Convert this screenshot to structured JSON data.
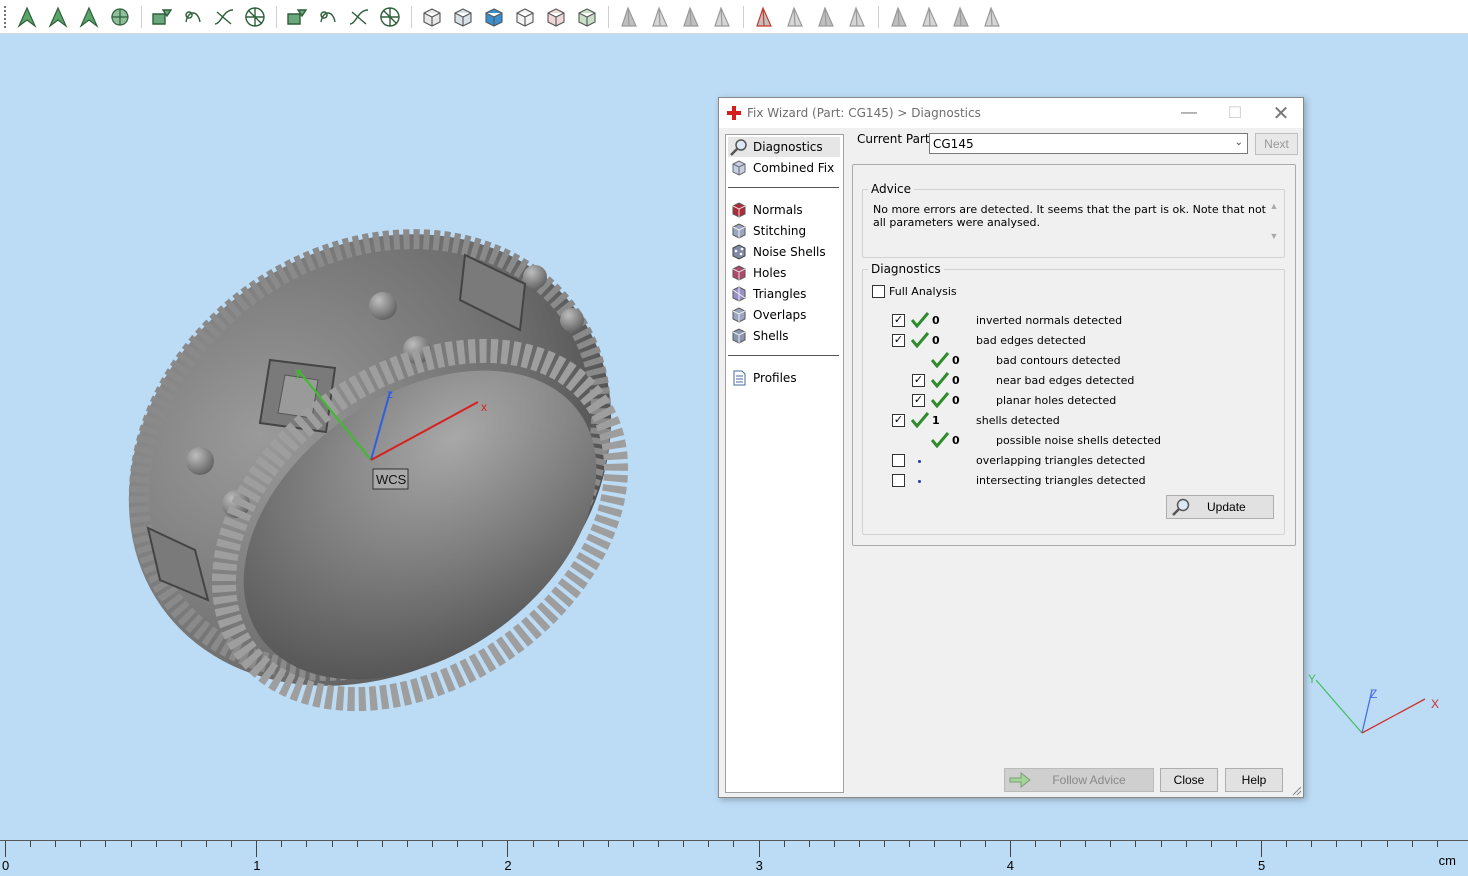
{
  "toolbar": {
    "icons": [
      "select-arrow-icon",
      "select-surface-icon",
      "select-edge-icon",
      "select-shell-icon",
      "mark-plane-icon",
      "mark-surface-icon",
      "mark-curve-icon",
      "mark-triangle-icon",
      "mark-shells-icon",
      "mark-noise-icon",
      "mark-wave-icon",
      "mark-cross-icon",
      "view-front-icon",
      "view-back-icon",
      "view-top-icon",
      "view-bottom-icon",
      "view-left-icon",
      "view-right-icon",
      "triangle-tool-icon",
      "triangle-split-icon",
      "triangle-edit-icon",
      "triangle-color-icon",
      "delete-triangle-icon",
      "triangle-fill-icon",
      "triangle-copy-icon",
      "triangle-outline-icon",
      "measure-icon",
      "measure-angle-icon",
      "measure-distance-icon",
      "measure-area-icon"
    ]
  },
  "viewport": {
    "wcs_label": "WCS",
    "axis_x": "x",
    "axis_y": "y",
    "axis_z": "z",
    "mini_axes": {
      "x": "X",
      "y": "Y",
      "z": "Z"
    }
  },
  "ruler": {
    "labels": [
      "0",
      "1",
      "2",
      "3",
      "4",
      "5"
    ],
    "unit": "cm"
  },
  "dialog": {
    "title": "Fix Wizard (Part: CG145) > Diagnostics",
    "nav": {
      "diagnostics": "Diagnostics",
      "combined_fix": "Combined Fix",
      "normals": "Normals",
      "stitching": "Stitching",
      "noise_shells": "Noise Shells",
      "holes": "Holes",
      "triangles": "Triangles",
      "overlaps": "Overlaps",
      "shells": "Shells",
      "profiles": "Profiles"
    },
    "current_part_label": "Current Part:",
    "current_part_value": "CG145",
    "next_label": "Next",
    "advice_legend": "Advice",
    "advice_text": "No more errors are detected. It seems that the part is ok. Note that not all parameters were analysed.",
    "diagnostics_legend": "Diagnostics",
    "full_analysis_label": "Full Analysis",
    "rows": [
      {
        "count": "0",
        "label": "inverted normals detected"
      },
      {
        "count": "0",
        "label": "bad edges detected"
      },
      {
        "count": "0",
        "label": "bad contours detected"
      },
      {
        "count": "0",
        "label": "near bad edges detected"
      },
      {
        "count": "0",
        "label": "planar holes detected"
      },
      {
        "count": "1",
        "label": "shells detected"
      },
      {
        "count": "0",
        "label": "possible noise shells detected"
      },
      {
        "count": "",
        "label": "overlapping triangles detected"
      },
      {
        "count": "",
        "label": "intersecting triangles detected"
      }
    ],
    "update_label": "Update",
    "follow_advice_label": "Follow Advice",
    "close_label": "Close",
    "help_label": "Help"
  }
}
